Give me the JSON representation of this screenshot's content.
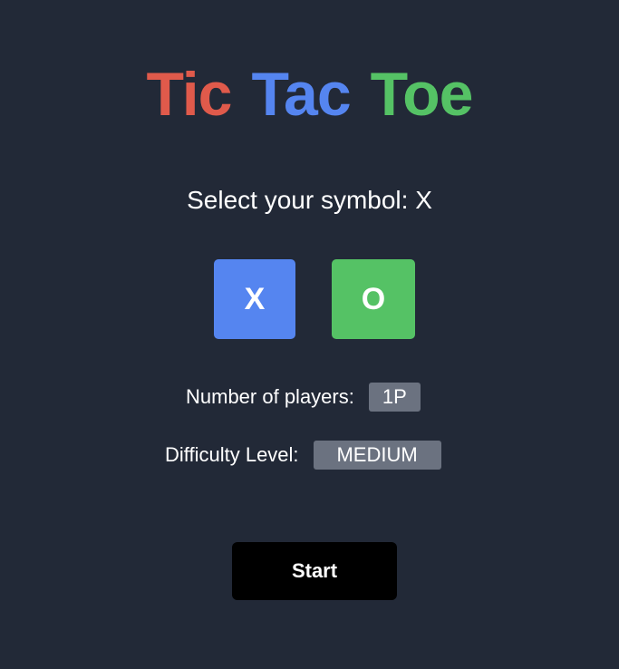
{
  "title": {
    "words": [
      "Tic",
      "Tac",
      "Toe"
    ],
    "colors": [
      "#e05a4b",
      "#5585f0",
      "#55c265"
    ]
  },
  "symbol_select": {
    "prompt": "Select your symbol: X",
    "options": [
      {
        "label": "X",
        "color": "#5585f0"
      },
      {
        "label": "O",
        "color": "#55c265"
      }
    ],
    "selected": "X"
  },
  "players": {
    "label": "Number of players:",
    "value": "1P"
  },
  "difficulty": {
    "label": "Difficulty Level:",
    "value": "MEDIUM"
  },
  "start_button": {
    "label": "Start"
  },
  "colors": {
    "background": "#222937",
    "pill": "#6b7280",
    "start": "#000000"
  }
}
